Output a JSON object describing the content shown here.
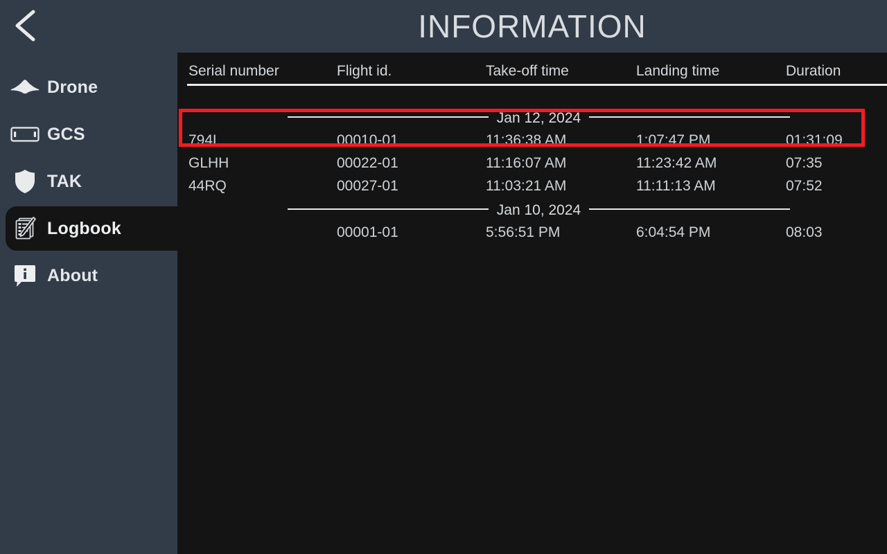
{
  "header": {
    "title": "INFORMATION",
    "back_icon": "chevron-left-icon"
  },
  "sidebar": {
    "items": [
      {
        "label": "Drone",
        "icon": "drone-icon",
        "active": false
      },
      {
        "label": "GCS",
        "icon": "tablet-icon",
        "active": false
      },
      {
        "label": "TAK",
        "icon": "shield-icon",
        "active": false
      },
      {
        "label": "Logbook",
        "icon": "notepad-pen-icon",
        "active": true
      },
      {
        "label": "About",
        "icon": "info-bubble-icon",
        "active": false
      }
    ]
  },
  "logbook": {
    "columns": [
      "Serial number",
      "Flight id.",
      "Take-off time",
      "Landing time",
      "Duration"
    ],
    "groups": [
      {
        "date": "Jan 12, 2024",
        "rows": [
          {
            "serial": "794L",
            "flight_id": "00010-01",
            "takeoff": "11:36:38 AM",
            "landing": "1:07:47 PM",
            "duration": "01:31:09",
            "highlighted": true
          },
          {
            "serial": "GLHH",
            "flight_id": "00022-01",
            "takeoff": "11:16:07 AM",
            "landing": "11:23:42 AM",
            "duration": "07:35",
            "highlighted": false
          },
          {
            "serial": "44RQ",
            "flight_id": "00027-01",
            "takeoff": "11:03:21 AM",
            "landing": "11:11:13 AM",
            "duration": "07:52",
            "highlighted": false
          }
        ]
      },
      {
        "date": "Jan 10, 2024",
        "rows": [
          {
            "serial": "",
            "flight_id": "00001-01",
            "takeoff": "5:56:51 PM",
            "landing": "6:04:54 PM",
            "duration": "08:03",
            "highlighted": false
          }
        ]
      }
    ]
  },
  "colors": {
    "sidebar_bg": "#323C48",
    "panel_bg": "#141414",
    "text": "#D4D8DC",
    "highlight_box": "#F51B22"
  }
}
